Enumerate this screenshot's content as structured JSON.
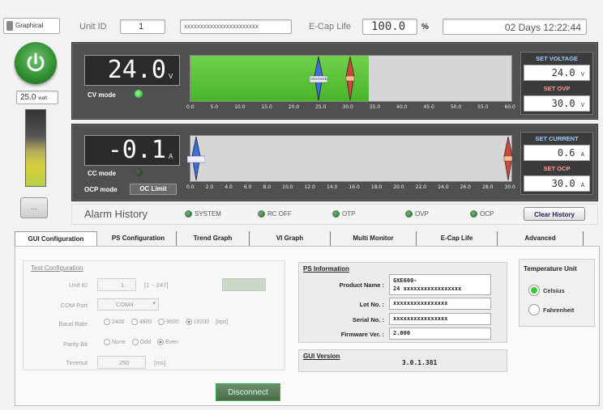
{
  "topbar": {
    "graphical_label": "Graphical",
    "unit_id_label": "Unit ID",
    "unit_id_value": "1",
    "serial_field": "xxxxxxxxxxxxxxxxxxxxxxx",
    "ecap_label": "E-Cap Life",
    "ecap_value": "100.0",
    "ecap_unit": "%",
    "elapsed": "02 Days 12:22:44"
  },
  "left": {
    "watt_value": "25.0",
    "watt_unit": "watt",
    "small_button_label": "..."
  },
  "voltage_panel": {
    "readout": "24.0",
    "unit": "V",
    "mode_label": "CV mode",
    "mode_led": "on",
    "fill_fraction": 0.555,
    "scale": [
      "0.0",
      "5.0",
      "10.0",
      "15.0",
      "20.0",
      "25.0",
      "30.0",
      "35.0",
      "40.0",
      "45.0",
      "50.0",
      "55.0",
      "60.0"
    ],
    "marker_label": "VOLTAGE",
    "set_title": "SET VOLTAGE",
    "set_value": "24.0",
    "set_unit": "V",
    "limit_title": "SET OVP",
    "limit_value": "30.0",
    "limit_unit": "V"
  },
  "current_panel": {
    "readout": "-0.1",
    "unit": "A",
    "mode_label": "CC mode",
    "ocp_label": "OCP mode",
    "ocp_state": "OC Limit",
    "fill_fraction": 0.0,
    "scale": [
      "0.0",
      "2.0",
      "4.0",
      "6.0",
      "8.0",
      "10.0",
      "12.0",
      "14.0",
      "16.0",
      "18.0",
      "20.0",
      "22.0",
      "24.0",
      "26.0",
      "28.0",
      "30.0"
    ],
    "set_title": "SET CURRENT",
    "set_value": "0.6",
    "set_unit": "A",
    "limit_title": "SET OCP",
    "limit_value": "30.0",
    "limit_unit": "A"
  },
  "alarms": {
    "title": "Alarm History",
    "items": [
      "SYSTEM",
      "RC OFF",
      "OTP",
      "OVP",
      "OCP"
    ],
    "clear_label": "Clear History"
  },
  "tabs": [
    "GUI Configuration",
    "PS Configuration",
    "Trend Graph",
    "VI Graph",
    "Multi Monitor",
    "E-Cap Life",
    "Advanced"
  ],
  "test_config": {
    "title": "Test Configuration",
    "unit_id_label": "Unit ID",
    "unit_id_value": "1",
    "unit_id_range": "[1 ~ 247]",
    "com_label": "COM Port",
    "com_value": "COM4",
    "baud_label": "Baud Rate",
    "baud_options": [
      "2400",
      "4800",
      "9600",
      "19200"
    ],
    "baud_unit": "[bps]",
    "parity_label": "Parity Bit",
    "parity_options": [
      "None",
      "Odd",
      "Even"
    ],
    "timeout_label": "Timeout",
    "timeout_value": "250",
    "timeout_unit": "[ms]"
  },
  "ps_info": {
    "title": "PS Information",
    "product_label": "Product Name :",
    "product_value_1": "GXE600-",
    "product_value_2": "24  xxxxxxxxxxxxxxxxx",
    "lot_label": "Lot No. :",
    "lot_value": "xxxxxxxxxxxxxxxx",
    "serial_label": "Serial No. :",
    "serial_value": "xxxxxxxxxxxxxxxx",
    "firmware_label": "Firmware Ver. :",
    "firmware_value": "2.000",
    "gui_version_label": "GUI Version",
    "gui_version_value": "3.0.1.381"
  },
  "temperature": {
    "title": "Temperature Unit",
    "options": [
      "Celsius",
      "Fahrenheit"
    ],
    "selected": "Celsius"
  },
  "connect_button": "Disconnect"
}
